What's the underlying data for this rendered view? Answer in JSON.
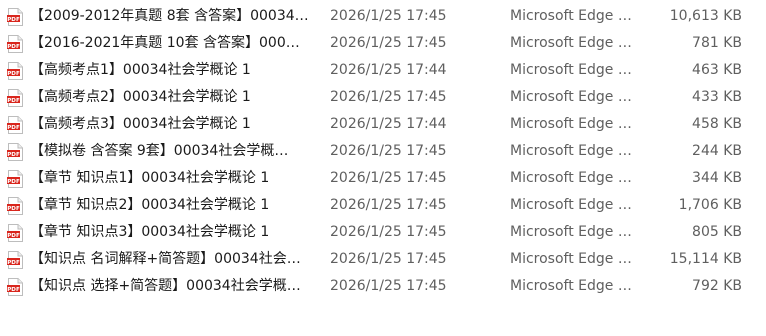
{
  "colors": {
    "pdf_icon_red": "#d9251c",
    "secondary_text": "#5f5f5f",
    "primary_text": "#1a1a1a"
  },
  "icon_name": "pdf-file-icon",
  "icon_text": "PDF",
  "files": [
    {
      "name": "【2009-2012年真题 8套 含答案】00034…",
      "date": "2026/1/25 17:45",
      "type": "Microsoft Edge …",
      "size": "10,613 KB"
    },
    {
      "name": "【2016-2021年真题 10套 含答案】000…",
      "date": "2026/1/25 17:45",
      "type": "Microsoft Edge …",
      "size": "781 KB"
    },
    {
      "name": "【高频考点1】00034社会学概论 1",
      "date": "2026/1/25 17:44",
      "type": "Microsoft Edge …",
      "size": "463 KB"
    },
    {
      "name": "【高频考点2】00034社会学概论 1",
      "date": "2026/1/25 17:45",
      "type": "Microsoft Edge …",
      "size": "433 KB"
    },
    {
      "name": "【高频考点3】00034社会学概论 1",
      "date": "2026/1/25 17:44",
      "type": "Microsoft Edge …",
      "size": "458 KB"
    },
    {
      "name": "【模拟卷 含答案 9套】00034社会学概…",
      "date": "2026/1/25 17:45",
      "type": "Microsoft Edge …",
      "size": "244 KB"
    },
    {
      "name": "【章节 知识点1】00034社会学概论 1",
      "date": "2026/1/25 17:45",
      "type": "Microsoft Edge …",
      "size": "344 KB"
    },
    {
      "name": "【章节 知识点2】00034社会学概论 1",
      "date": "2026/1/25 17:45",
      "type": "Microsoft Edge …",
      "size": "1,706 KB"
    },
    {
      "name": "【章节 知识点3】00034社会学概论 1",
      "date": "2026/1/25 17:45",
      "type": "Microsoft Edge …",
      "size": "805 KB"
    },
    {
      "name": "【知识点 名词解释+简答题】00034社会…",
      "date": "2026/1/25 17:45",
      "type": "Microsoft Edge …",
      "size": "15,114 KB"
    },
    {
      "name": "【知识点 选择+简答题】00034社会学概…",
      "date": "2026/1/25 17:45",
      "type": "Microsoft Edge …",
      "size": "792 KB"
    }
  ]
}
